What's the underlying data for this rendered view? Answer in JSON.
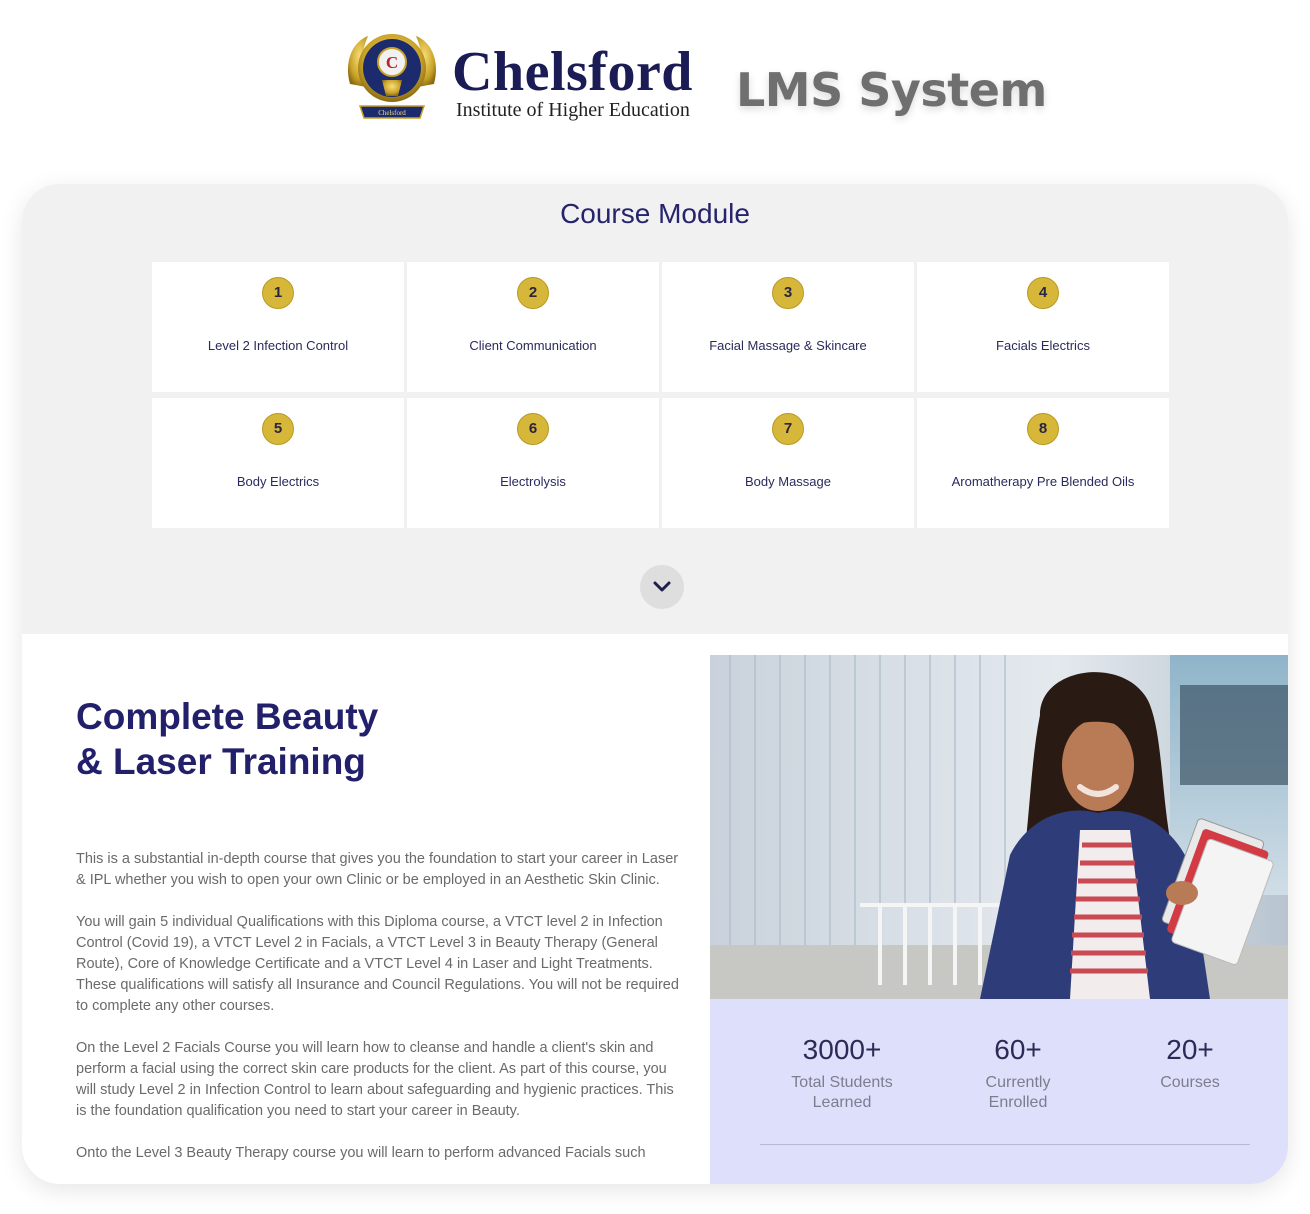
{
  "header": {
    "brand_name": "Chelsford",
    "brand_subtitle": "Institute of Higher Education",
    "logo_letter": "C",
    "logo_ribbon": "Chelsford",
    "app_title": "LMS System"
  },
  "modules": {
    "heading": "Course Module",
    "items": [
      {
        "number": "1",
        "name": "Level 2 Infection Control"
      },
      {
        "number": "2",
        "name": "Client Communication"
      },
      {
        "number": "3",
        "name": "Facial Massage & Skincare"
      },
      {
        "number": "4",
        "name": "Facials Electrics"
      },
      {
        "number": "5",
        "name": "Body Electrics"
      },
      {
        "number": "6",
        "name": "Electrolysis"
      },
      {
        "number": "7",
        "name": "Body Massage"
      },
      {
        "number": "8",
        "name": "Aromatherapy Pre Blended Oils"
      }
    ],
    "expand_icon": "chevron-down-icon"
  },
  "course": {
    "title_line1": "Complete Beauty",
    "title_line2": "& Laser Training",
    "paragraphs": [
      "This is a substantial in-depth course that gives you the foundation to start your career in Laser & IPL whether you wish to open your own Clinic or be employed in an Aesthetic Skin Clinic.",
      "You will gain 5 individual Qualifications with this Diploma course, a VTCT level 2 in Infection Control (Covid 19), a VTCT Level 2 in Facials, a VTCT Level 3 in Beauty Therapy (General Route), Core of Knowledge Certificate and a VTCT Level 4 in Laser and Light Treatments. These qualifications will satisfy all Insurance and Council Regulations. You will not be required to complete any other courses.",
      "On the Level 2 Facials Course you will learn how to cleanse and handle a client's skin and perform a facial using the correct skin care products for the client. As part of this course, you will study Level 2 in Infection Control to learn about safeguarding and hygienic practices. This is the foundation qualification you need to start your career in Beauty.",
      "Onto the Level 3 Beauty Therapy course you will learn to perform advanced Facials such"
    ]
  },
  "stats": [
    {
      "value": "3000+",
      "label_line1": "Total Students",
      "label_line2": "Learned"
    },
    {
      "value": "60+",
      "label_line1": "Currently",
      "label_line2": "Enrolled"
    },
    {
      "value": "20+",
      "label_line1": "Courses",
      "label_line2": ""
    }
  ],
  "colors": {
    "navy": "#23206b",
    "gold": "#d6b73a",
    "module_bg": "#f1f1f1",
    "stats_bg": "#dedffa"
  }
}
